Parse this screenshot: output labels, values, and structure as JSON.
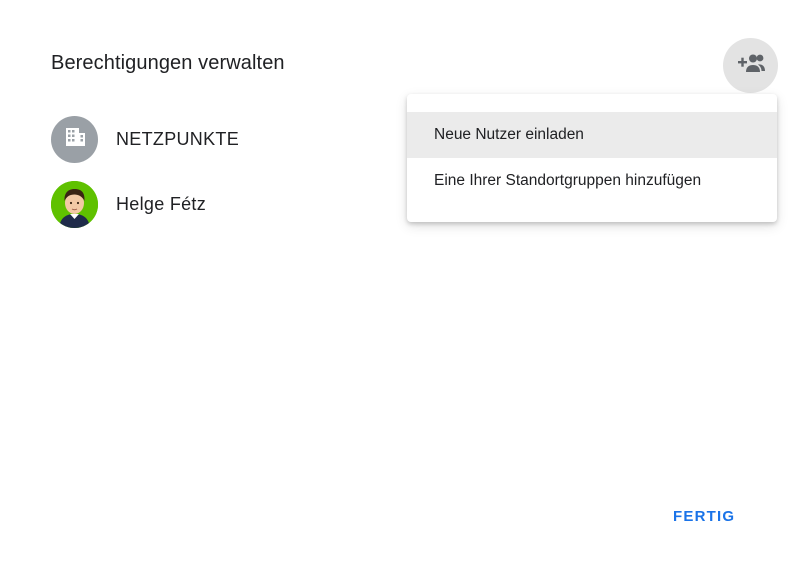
{
  "dialog": {
    "title": "Berechtigungen verwalten",
    "add_button_icon": "person-add-icon",
    "done_label": "FERTIG"
  },
  "members": [
    {
      "name": "NETZPUNKTE",
      "avatar": "building-icon",
      "avatar_color": "#9aa0a6"
    },
    {
      "name": "Helge Fétz",
      "avatar": "person-avatar",
      "avatar_color": "#5fc100"
    }
  ],
  "menu": {
    "items": [
      {
        "label": "Neue Nutzer einladen",
        "highlighted": true
      },
      {
        "label": "Eine Ihrer Standortgruppen hinzufügen",
        "highlighted": false
      }
    ]
  },
  "colors": {
    "accent": "#1a73e8",
    "text": "#202124",
    "icon": "#5f6368",
    "highlight": "#ebebeb"
  }
}
